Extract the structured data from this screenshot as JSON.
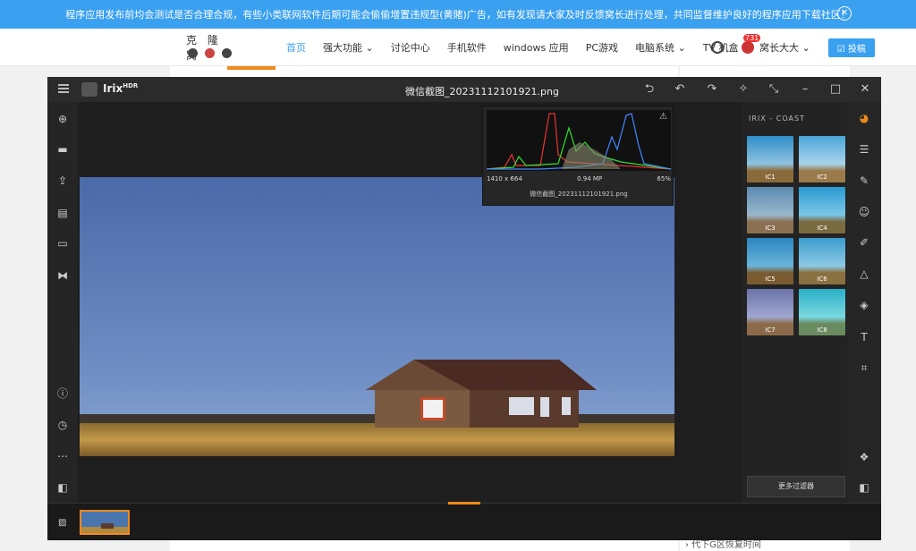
{
  "banner": {
    "text": "程序应用发布前均会测试是否合理合规，有些小类联网软件后期可能会偷偷增置违规型(黄賭)广告，如有发现请大家及时反馈窝长进行处理，共同监督维护良好的程序应用下载社区！",
    "close": "✕"
  },
  "site": {
    "logo": "克 隆 窝",
    "nav": [
      "首页",
      "强大功能 ⌄",
      "讨论中心",
      "手机软件",
      "windows 应用",
      "PC游戏",
      "电脑系统 ⌄",
      "TV 机盒"
    ],
    "user": "窝长大大 ⌄",
    "badge": "731",
    "post_button": "☑ 投稿",
    "side_link": "› 代下G区恢复时间"
  },
  "app": {
    "name": "Irix",
    "name_sup": "HDR",
    "file_title": "微信截图_20231112101921.png",
    "histogram": {
      "dimensions": "1410 x 664",
      "megapixels": "0.94 MP",
      "zoom": "65%",
      "filename": "微信截图_20231112101921.png",
      "warning_icon": "⚠"
    },
    "panel_title": "IRIX - COAST",
    "presets": [
      "IC1",
      "IC2",
      "IC3",
      "IC4",
      "IC5",
      "IC6",
      "IC7",
      "IC8"
    ],
    "more_filters": "更多过滤器",
    "titlebar_icons": [
      "undo-all",
      "undo",
      "redo",
      "magic-wand",
      "collapse",
      "minimize",
      "maximize",
      "close"
    ],
    "left_icons": [
      "add",
      "folder",
      "export",
      "print",
      "window",
      "compare",
      "info",
      "history",
      "more",
      "split"
    ],
    "right_tools": [
      "presets",
      "adjust",
      "brush",
      "face",
      "eyedropper",
      "tone",
      "layers",
      "text",
      "crop",
      "plugins",
      "compare-split"
    ]
  }
}
